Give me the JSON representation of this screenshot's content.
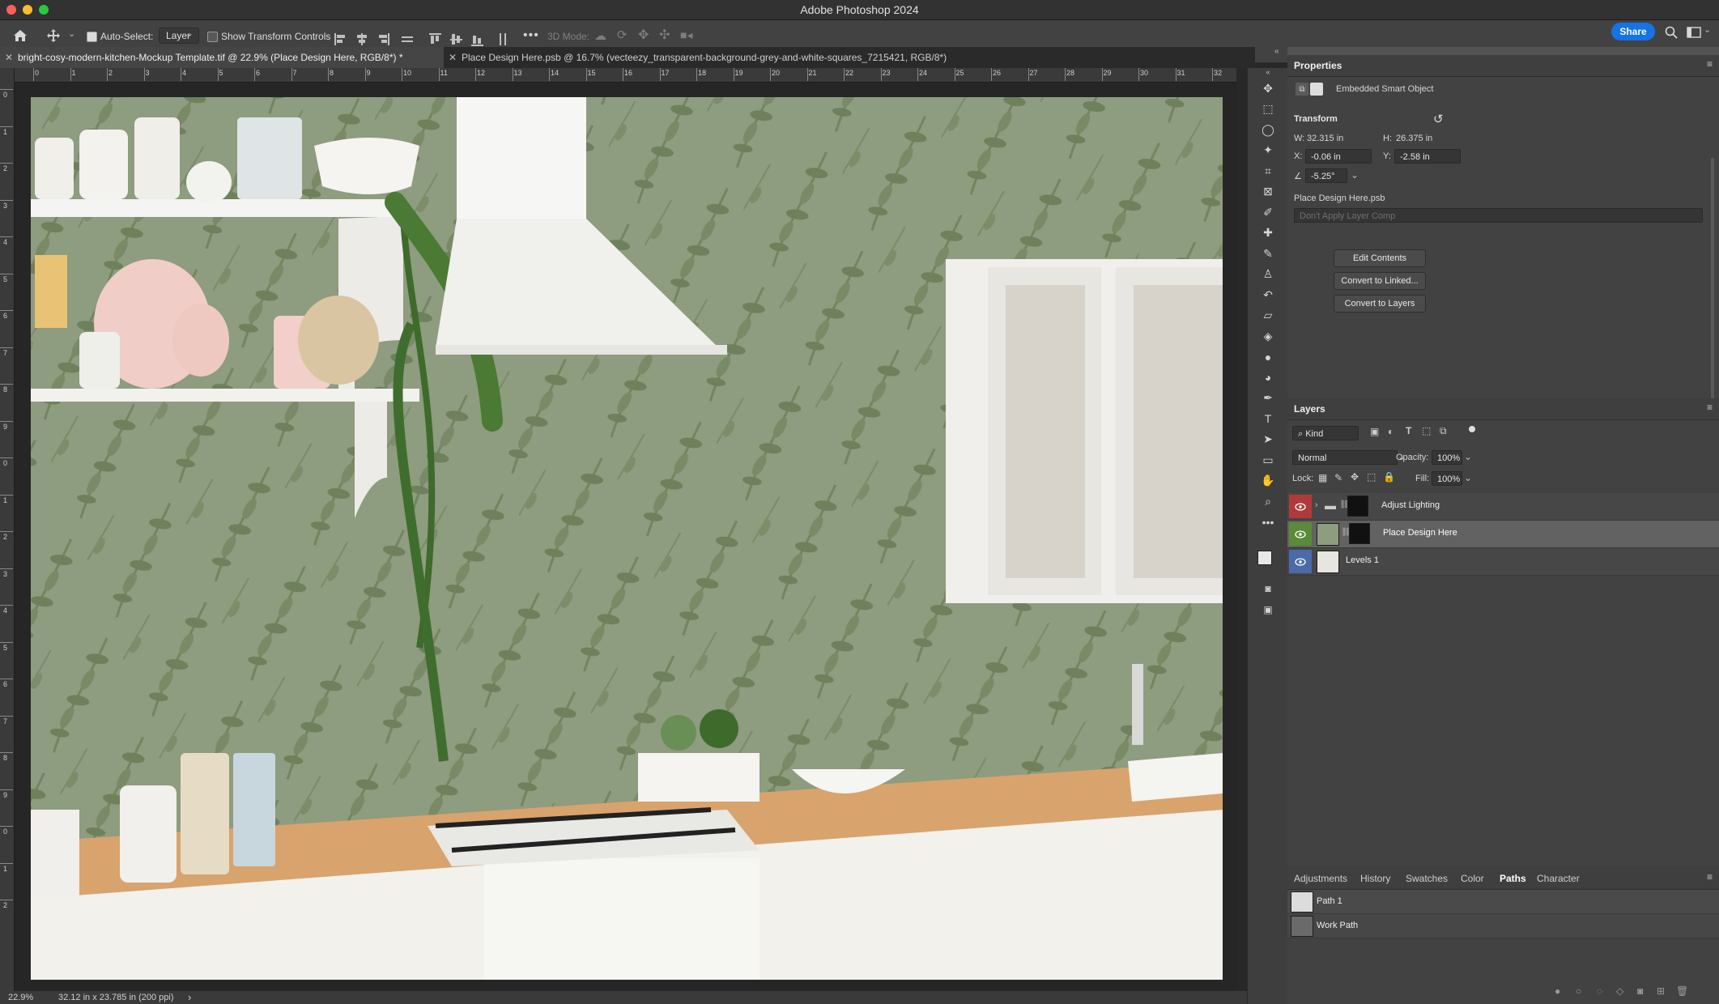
{
  "app_title": "Adobe Photoshop 2024",
  "options_bar": {
    "auto_select_label": "Auto-Select:",
    "auto_select_value": "Layer",
    "show_transform_label": "Show Transform Controls",
    "mode_3d_label": "3D Mode:",
    "share_label": "Share"
  },
  "tabs": [
    {
      "label": "bright-cosy-modern-kitchen-Mockup Template.tif @ 22.9% (Place Design Here, RGB/8*) *"
    },
    {
      "label": "Place Design Here.psb @ 16.7% (vecteezy_transparent-background-grey-and-white-squares_7215421, RGB/8*)"
    }
  ],
  "ruler_top_labels": [
    "0",
    "1",
    "2",
    "3",
    "4",
    "5",
    "6",
    "7",
    "8",
    "9",
    "10",
    "11",
    "12",
    "13",
    "14",
    "15",
    "16",
    "17",
    "18",
    "19",
    "20",
    "21",
    "22",
    "23",
    "24",
    "25",
    "26",
    "27",
    "28",
    "29",
    "30",
    "31",
    "32"
  ],
  "ruler_left_labels": [
    "0",
    "1",
    "2",
    "3",
    "4",
    "5",
    "6",
    "7",
    "8",
    "9",
    "0",
    "1",
    "2",
    "3",
    "4",
    "5",
    "6",
    "7",
    "8",
    "9",
    "0",
    "1",
    "2"
  ],
  "status": {
    "zoom": "22.9%",
    "doc_info": "32.12 in x 23.785 in (200 ppi)",
    "arrow": "›"
  },
  "properties": {
    "title": "Properties",
    "object_type": "Embedded Smart Object",
    "transform_label": "Transform",
    "w_label": "W:",
    "w_value": "32.315 in",
    "h_label": "H:",
    "h_value": "26.375 in",
    "x_label": "X:",
    "x_value": "-0.06 in",
    "y_label": "Y:",
    "y_value": "-2.58 in",
    "angle_value": "-5.25°",
    "file_name": "Place Design Here.psb",
    "layer_comp_placeholder": "Don't Apply Layer Comp",
    "btn_edit": "Edit Contents",
    "btn_linked": "Convert to Linked...",
    "btn_layers": "Convert to Layers"
  },
  "layers": {
    "title": "Layers",
    "kind_label": "Kind",
    "blend_mode": "Normal",
    "opacity_label": "Opacity:",
    "opacity_value": "100%",
    "lock_label": "Lock:",
    "fill_label": "Fill:",
    "fill_value": "100%",
    "items": [
      {
        "name": "Adjust Lighting",
        "eye_color": "#b03a3a"
      },
      {
        "name": "Place Design Here",
        "eye_color": "#5a8a3a"
      },
      {
        "name": "Levels 1",
        "eye_color": "#4a6aa8"
      }
    ]
  },
  "bottom_tabs": [
    "Adjustments",
    "History",
    "Swatches",
    "Color",
    "Paths",
    "Character"
  ],
  "active_bottom_tab": "Paths",
  "paths": [
    {
      "name": "Path 1"
    },
    {
      "name": "Work Path"
    }
  ],
  "colors": {
    "accent": "#1473e6",
    "wallpaper": "#8c9a7d",
    "panel_bg": "#424242"
  }
}
